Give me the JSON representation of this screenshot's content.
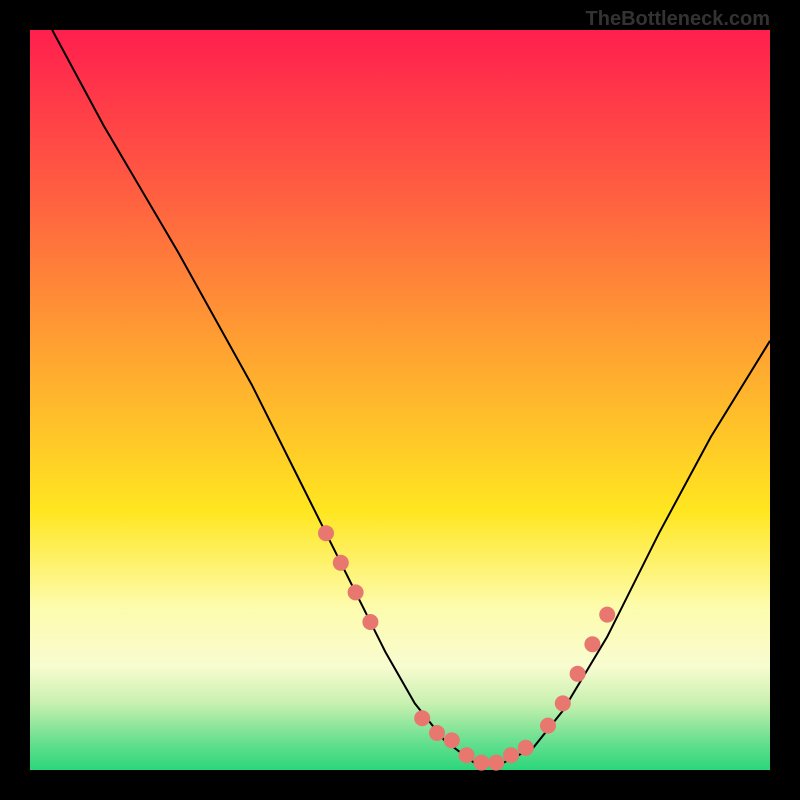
{
  "watermark": "TheBottleneck.com",
  "colors": {
    "border": "#000000",
    "curve": "#000000",
    "points": "#e8776f",
    "gradient_top": "#ff1f4e",
    "gradient_mid1": "#ff6040",
    "gradient_mid2": "#ffb030",
    "gradient_mid3": "#ffe820",
    "gradient_mid4": "#fdfcad",
    "gradient_bottom": "#2bd67b"
  },
  "chart_data": {
    "type": "line",
    "title": "",
    "xlabel": "",
    "ylabel": "",
    "xlim": [
      0,
      100
    ],
    "ylim": [
      0,
      100
    ],
    "series": [
      {
        "name": "curve",
        "x": [
          3,
          10,
          20,
          30,
          36,
          42,
          48,
          52,
          56,
          60,
          64,
          68,
          72,
          78,
          85,
          92,
          100
        ],
        "y": [
          100,
          87,
          70,
          52,
          40,
          28,
          16,
          9,
          4,
          1,
          1,
          3,
          8,
          18,
          32,
          45,
          58
        ]
      }
    ],
    "points": {
      "name": "highlighted",
      "x": [
        40,
        42,
        44,
        46,
        53,
        55,
        57,
        59,
        61,
        63,
        65,
        67,
        70,
        72,
        74,
        76,
        78
      ],
      "y": [
        32,
        28,
        24,
        20,
        7,
        5,
        4,
        2,
        1,
        1,
        2,
        3,
        6,
        9,
        13,
        17,
        21
      ]
    }
  }
}
